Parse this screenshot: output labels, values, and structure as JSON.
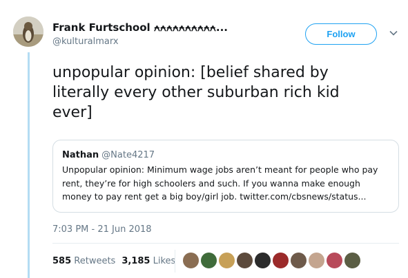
{
  "user": {
    "display_name": "Frank Furtschool ⍲⍲⍲⍲⍲⍲⍲⍲⍲⍲...",
    "handle": "@kulturalmarx"
  },
  "follow_label": "Follow",
  "tweet_text": "unpopular opinion: [belief shared by literally every other suburban rich kid ever]",
  "quoted_tweet": {
    "name": "Nathan",
    "handle": "@Nate4217",
    "text": "Unpopular opinion: Minimum wage jobs aren’t meant for people who pay rent, they’re for high schoolers and such. If you wanna make enough money to pay rent get a big boy/girl job. twitter.com/cbsnews/status..."
  },
  "timestamp": "7:03 PM - 21 Jun 2018",
  "stats": {
    "retweets_count": "585",
    "retweets_label": "Retweets",
    "likes_count": "3,185",
    "likes_label": "Likes"
  },
  "colors": {
    "accent": "#1da1f2",
    "thread_line": "#b4dcf3",
    "muted_text": "#657786"
  },
  "icons": {
    "menu": "chevron-down-icon"
  }
}
